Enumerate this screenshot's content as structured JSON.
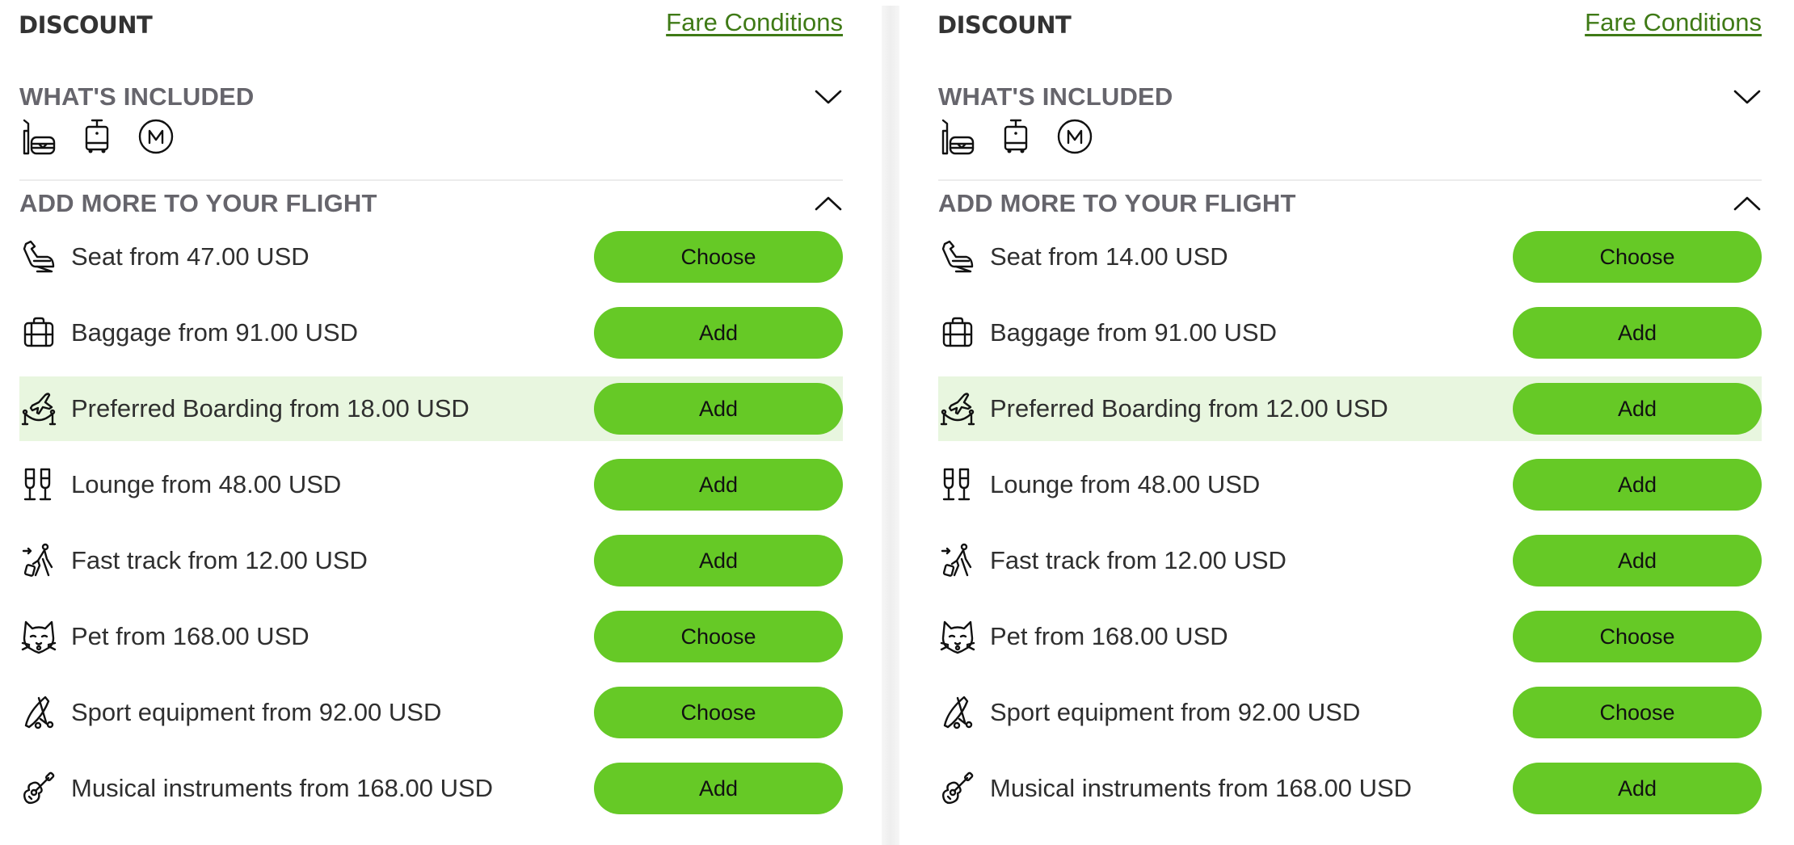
{
  "panels": [
    {
      "title": "DISCOUNT",
      "fare_conditions_link": "Fare Conditions",
      "whats_included": {
        "label": "WHAT'S INCLUDED",
        "expanded": false,
        "icons": [
          "snack-drink-icon",
          "cabin-bag-icon",
          "miles-icon"
        ]
      },
      "add_more": {
        "label": "ADD MORE TO YOUR FLIGHT",
        "expanded": true,
        "items": [
          {
            "icon": "seat-icon",
            "label": "Seat from 47.00 USD",
            "button": "Choose",
            "highlighted": false
          },
          {
            "icon": "baggage-icon",
            "label": "Baggage from 91.00 USD",
            "button": "Add",
            "highlighted": false
          },
          {
            "icon": "preferred-boarding-icon",
            "label": "Preferred Boarding from 18.00 USD",
            "button": "Add",
            "highlighted": true
          },
          {
            "icon": "lounge-icon",
            "label": "Lounge from 48.00 USD",
            "button": "Add",
            "highlighted": false
          },
          {
            "icon": "fast-track-icon",
            "label": "Fast track from 12.00 USD",
            "button": "Add",
            "highlighted": false
          },
          {
            "icon": "pet-icon",
            "label": "Pet from 168.00 USD",
            "button": "Choose",
            "highlighted": false
          },
          {
            "icon": "sport-equipment-icon",
            "label": "Sport equipment from 92.00 USD",
            "button": "Choose",
            "highlighted": false
          },
          {
            "icon": "musical-instrument-icon",
            "label": "Musical instruments from 168.00 USD",
            "button": "Add",
            "highlighted": false
          }
        ]
      }
    },
    {
      "title": "DISCOUNT",
      "fare_conditions_link": "Fare Conditions",
      "whats_included": {
        "label": "WHAT'S INCLUDED",
        "expanded": false,
        "icons": [
          "snack-drink-icon",
          "cabin-bag-icon",
          "miles-icon"
        ]
      },
      "add_more": {
        "label": "ADD MORE TO YOUR FLIGHT",
        "expanded": true,
        "items": [
          {
            "icon": "seat-icon",
            "label": "Seat from 14.00 USD",
            "button": "Choose",
            "highlighted": false
          },
          {
            "icon": "baggage-icon",
            "label": "Baggage from 91.00 USD",
            "button": "Add",
            "highlighted": false
          },
          {
            "icon": "preferred-boarding-icon",
            "label": "Preferred Boarding from 12.00 USD",
            "button": "Add",
            "highlighted": true
          },
          {
            "icon": "lounge-icon",
            "label": "Lounge from 48.00 USD",
            "button": "Add",
            "highlighted": false
          },
          {
            "icon": "fast-track-icon",
            "label": "Fast track from 12.00 USD",
            "button": "Add",
            "highlighted": false
          },
          {
            "icon": "pet-icon",
            "label": "Pet from 168.00 USD",
            "button": "Choose",
            "highlighted": false
          },
          {
            "icon": "sport-equipment-icon",
            "label": "Sport equipment from 92.00 USD",
            "button": "Choose",
            "highlighted": false
          },
          {
            "icon": "musical-instrument-icon",
            "label": "Musical instruments from 168.00 USD",
            "button": "Add",
            "highlighted": false
          }
        ]
      }
    }
  ],
  "colors": {
    "button_bg": "#66c926",
    "highlight_row_bg": "#e8f6df",
    "link": "#3f7a16",
    "section_label": "#66656c",
    "title": "#333333"
  }
}
